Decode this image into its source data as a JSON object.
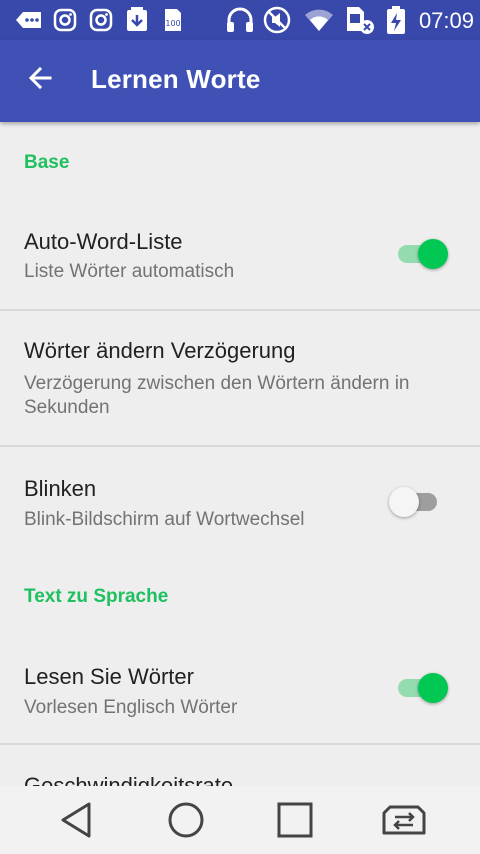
{
  "status_bar": {
    "time": "07:09",
    "icons": [
      "message-icon",
      "instagram-icon",
      "instagram-icon",
      "download-icon",
      "storage-icon",
      "headphones-icon",
      "mute-icon",
      "wifi-icon",
      "sim-off-icon",
      "battery-charging-icon"
    ]
  },
  "app_bar": {
    "title": "Lernen Worte",
    "back_icon": "arrow-back-icon"
  },
  "sections": {
    "base": {
      "label": "Base"
    },
    "tts": {
      "label": "Text zu Sprache"
    }
  },
  "settings": {
    "auto_word_list": {
      "title": "Auto-Word-Liste",
      "summary": "Liste Wörter automatisch",
      "enabled": true
    },
    "word_delay": {
      "title": "Wörter ändern Verzögerung",
      "summary": "Verzögerung zwischen den Wörtern ändern in Sekunden"
    },
    "blink": {
      "title": "Blinken",
      "summary": "Blink-Bildschirm auf Wortwechsel",
      "enabled": false
    },
    "read_words": {
      "title": "Lesen Sie Wörter",
      "summary": "Vorlesen Englisch Wörter",
      "enabled": true
    },
    "speech_rate": {
      "title": "Geschwindigkeitsrate"
    }
  },
  "nav_bar": {
    "icons": [
      "back-triangle-icon",
      "home-circle-icon",
      "recents-square-icon",
      "switch-app-icon"
    ]
  },
  "colors": {
    "status_bar": "#3949ab",
    "app_bar": "#3f51b5",
    "accent": "#1ec05f",
    "switch_on": "#00c853",
    "background": "#eeeeee"
  }
}
